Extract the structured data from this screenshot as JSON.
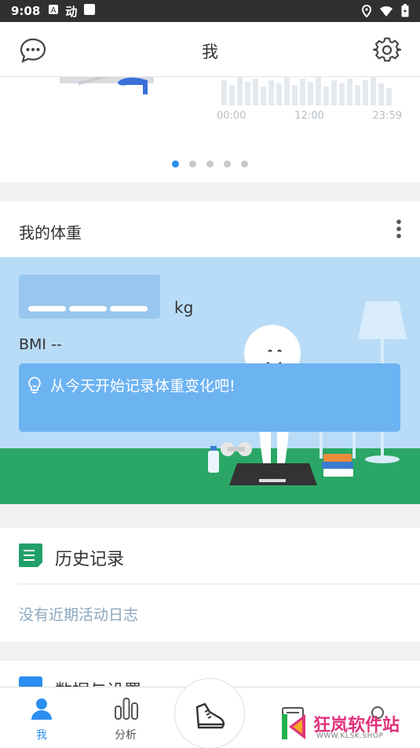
{
  "status_bar": {
    "time": "9:08",
    "app_badge": "动"
  },
  "header": {
    "title": "我"
  },
  "carousel": {
    "tick_labels": [
      "00:00",
      "12:00",
      "23:59"
    ],
    "page_count": 5,
    "active_page": 1
  },
  "weight_card": {
    "title": "我的体重",
    "unit": "kg",
    "bmi": "BMI --",
    "tip": "从今天开始记录体重变化吧!"
  },
  "history_card": {
    "title": "历史记录",
    "empty_text": "没有近期活动日志"
  },
  "settings_card": {
    "title": "数据与设置"
  },
  "bottom_nav": [
    {
      "label": "我",
      "icon": "person-icon",
      "active": true
    },
    {
      "label": "分析",
      "icon": "bar-chart-icon",
      "active": false
    },
    {
      "label": "",
      "icon": "running-shoe-icon",
      "active": false
    },
    {
      "label": "",
      "icon": "document-icon",
      "active": false
    },
    {
      "label": "",
      "icon": "community-icon",
      "active": false
    }
  ],
  "watermark": {
    "name": "狂岚软件站",
    "url": "WWW.KLSK.SHOP"
  },
  "colors": {
    "accent": "#2a8ff0",
    "floor": "#2aa766",
    "scene_bg": "#b8dcf7",
    "tip_bg": "#6cb3f2"
  }
}
